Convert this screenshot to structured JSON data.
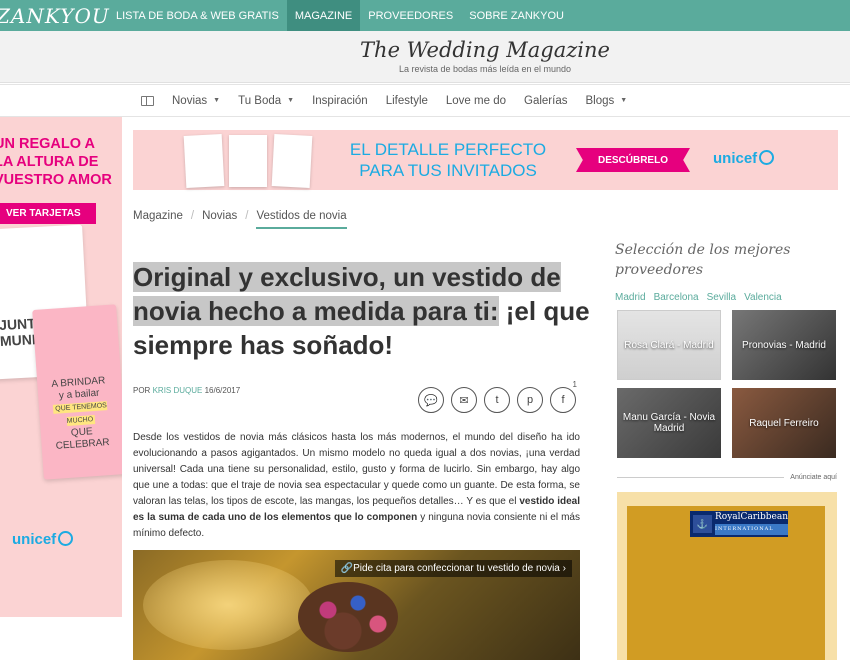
{
  "topbar": {
    "logo": "ZANKYOU",
    "items": [
      {
        "label": "LISTA DE BODA & WEB GRATIS",
        "active": false
      },
      {
        "label": "MAGAZINE",
        "active": true
      },
      {
        "label": "PROVEEDORES",
        "active": false
      },
      {
        "label": "SOBRE ZANKYOU",
        "active": false
      }
    ]
  },
  "masthead": {
    "title": "The Wedding Magazine",
    "subtitle": "La revista de bodas más leída en el mundo"
  },
  "secnav": {
    "icon": "book-icon",
    "items": [
      {
        "label": "Novias",
        "dropdown": true
      },
      {
        "label": "Tu Boda",
        "dropdown": true
      },
      {
        "label": "Inspiración",
        "dropdown": false
      },
      {
        "label": "Lifestyle",
        "dropdown": false
      },
      {
        "label": "Love me do",
        "dropdown": false
      },
      {
        "label": "Galerías",
        "dropdown": false
      },
      {
        "label": "Blogs",
        "dropdown": true
      }
    ]
  },
  "leftad": {
    "line1": "UN REGALO A",
    "line2": "LA ALTURA DE",
    "line3": "VUESTRO AMOR",
    "cta": "VER TARJETAS",
    "card1_text": "JUNTOS EL MUNDO",
    "card2_line1": "A BRINDAR",
    "card2_line2": "y a bailar",
    "card2_highlight": "QUE TENEMOS MUCHO",
    "card2_line3": "QUE CELEBRAR",
    "brand": "unicef"
  },
  "banner": {
    "line1": "EL DETALLE PERFECTO",
    "line2": "PARA TUS INVITADOS",
    "cta": "DESCÚBRELO",
    "brand": "unicef"
  },
  "breadcrumb": [
    "Magazine",
    "Novias",
    "Vestidos de novia"
  ],
  "article": {
    "title_highlight": "Original y exclusivo, un vestido de novia hecho a medida para ti:",
    "title_rest": " ¡el que siempre has soñado!",
    "by": "POR",
    "author": "KRIS DUQUE",
    "date": "16/6/2017",
    "share_count": "1",
    "body_1": "Desde los vestidos de novia más clásicos hasta los más modernos, el mundo del diseño ha ido evolucionando a pasos agigantados. Un mismo modelo no queda igual a dos novias, ¡una verdad universal! Cada una tiene su personalidad, estilo, gusto y forma de lucirlo. Sin embargo, hay algo que une a todas: que el traje de novia sea espectacular y quede como un guante. De esta forma, se valoran las telas, los tipos de escote, las mangas, los pequeños detalles… Y es que el ",
    "body_bold": "vestido ideal es la suma de cada uno de los elementos que lo componen",
    "body_2": " y ninguna novia consiente ni el más mínimo defecto.",
    "photo_cta": "Pide cita para confeccionar tu vestido de novia"
  },
  "sidebar": {
    "title": "Selección de los mejores proveedores",
    "cities": [
      "Madrid",
      "Barcelona",
      "Sevilla",
      "Valencia"
    ],
    "tiles": [
      "Rosa Clará - Madrid",
      "Pronovias - Madrid",
      "Manu García - Novia Madrid",
      "Raquel Ferreiro"
    ],
    "ad_label": "Anúnciate aquí",
    "ad_brand": "RoyalCaribbean",
    "ad_brand_sub": "INTERNATIONAL"
  }
}
